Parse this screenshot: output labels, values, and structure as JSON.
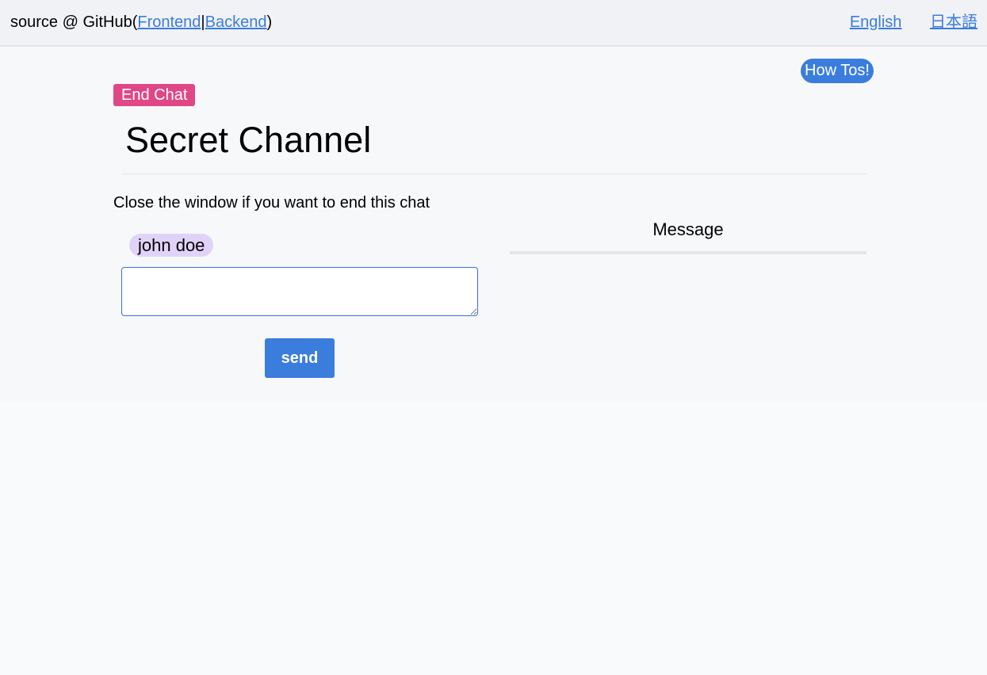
{
  "header": {
    "source_prefix": "source @ GitHub(",
    "frontend_link": "Frontend",
    "separator": "|",
    "backend_link": "Backend",
    "source_suffix": ")",
    "languages": [
      "English",
      "日本語"
    ]
  },
  "howtos_label": "How Tos!",
  "end_chat_label": "End Chat",
  "title": "Secret Channel",
  "notice": "Close the window if you want to end this chat",
  "user": {
    "name": "john doe"
  },
  "composer": {
    "value": "",
    "send_label": "send"
  },
  "messages": {
    "header": "Message",
    "items": []
  },
  "colors": {
    "accent": "#3b7ddd",
    "end_chat": "#df4787",
    "user_badge": "#e1d3f8"
  }
}
